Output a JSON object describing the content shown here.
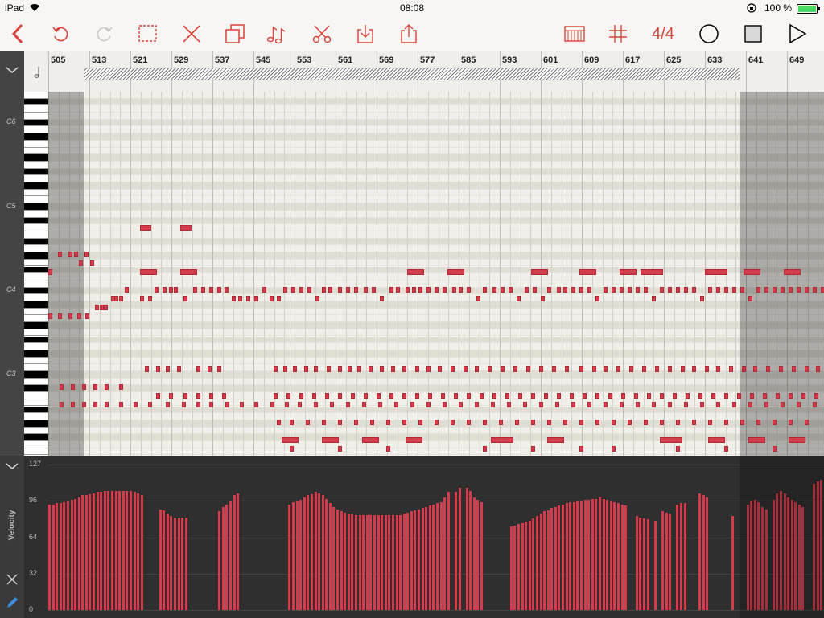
{
  "status": {
    "device": "iPad",
    "time": "08:08",
    "battery": "100 %"
  },
  "toolbar": {
    "back_icon": "chevron-left-icon",
    "time_signature": "4/4",
    "accent_color": "#d9443a"
  },
  "ruler": {
    "bars": [
      "505",
      "513",
      "521",
      "529",
      "537",
      "545",
      "553",
      "561",
      "569",
      "577",
      "585",
      "593",
      "601",
      "609",
      "617",
      "625",
      "633",
      "641",
      "649"
    ]
  },
  "keyboard": {
    "labels": [
      "C6",
      "C5",
      "C4",
      "C3"
    ]
  },
  "velocity": {
    "title": "Velocity",
    "levels": [
      "127",
      "96",
      "64",
      "32",
      "0"
    ]
  },
  "notes": [
    [
      0,
      7,
      1
    ],
    [
      12,
      5,
      1
    ],
    [
      25,
      5,
      1
    ],
    [
      32,
      5,
      1
    ],
    [
      38,
      6,
      1
    ],
    [
      45,
      5,
      1
    ],
    [
      52,
      6,
      1
    ],
    [
      0,
      12,
      1
    ],
    [
      12,
      12,
      1
    ],
    [
      25,
      12,
      1
    ],
    [
      36,
      12,
      1
    ],
    [
      46,
      12,
      1
    ],
    [
      58,
      11,
      1
    ],
    [
      64,
      11,
      1
    ],
    [
      69,
      11,
      1
    ],
    [
      78,
      10,
      1
    ],
    [
      82,
      10,
      1
    ],
    [
      88,
      10,
      1
    ],
    [
      95,
      9,
      1
    ],
    [
      114,
      10,
      1
    ],
    [
      124,
      10,
      1
    ],
    [
      132,
      9,
      1
    ],
    [
      142,
      9,
      1
    ],
    [
      150,
      9,
      1
    ],
    [
      156,
      9,
      1
    ],
    [
      168,
      10,
      1
    ],
    [
      180,
      9,
      1
    ],
    [
      190,
      9,
      1
    ],
    [
      200,
      9,
      1
    ],
    [
      210,
      9,
      1
    ],
    [
      219,
      9,
      1
    ],
    [
      228,
      10,
      1
    ],
    [
      236,
      10,
      1
    ],
    [
      246,
      10,
      1
    ],
    [
      256,
      10,
      1
    ],
    [
      266,
      9,
      1
    ],
    [
      275,
      10,
      1
    ],
    [
      284,
      10,
      1
    ],
    [
      292,
      9,
      1
    ],
    [
      302,
      9,
      1
    ],
    [
      312,
      9,
      1
    ],
    [
      322,
      9,
      1
    ],
    [
      332,
      10,
      1
    ],
    [
      340,
      9,
      1
    ],
    [
      348,
      9,
      1
    ],
    [
      360,
      9,
      1
    ],
    [
      370,
      9,
      1
    ],
    [
      380,
      9,
      1
    ],
    [
      392,
      9,
      1
    ],
    [
      402,
      9,
      1
    ],
    [
      412,
      10,
      1
    ],
    [
      424,
      9,
      1
    ],
    [
      432,
      9,
      1
    ],
    [
      444,
      9,
      1
    ],
    [
      452,
      9,
      1
    ],
    [
      460,
      9,
      1
    ],
    [
      470,
      9,
      1
    ],
    [
      480,
      9,
      1
    ],
    [
      490,
      9,
      1
    ],
    [
      502,
      9,
      1
    ],
    [
      510,
      9,
      1
    ],
    [
      520,
      9,
      1
    ],
    [
      532,
      10,
      1
    ],
    [
      540,
      9,
      1
    ],
    [
      552,
      9,
      1
    ],
    [
      562,
      9,
      1
    ],
    [
      572,
      9,
      1
    ],
    [
      582,
      10,
      1
    ],
    [
      592,
      9,
      1
    ],
    [
      602,
      9,
      1
    ],
    [
      612,
      10,
      1
    ],
    [
      620,
      9,
      1
    ],
    [
      632,
      9,
      1
    ],
    [
      640,
      9,
      1
    ],
    [
      650,
      9,
      1
    ],
    [
      660,
      9,
      1
    ],
    [
      670,
      9,
      1
    ],
    [
      680,
      10,
      1
    ],
    [
      690,
      9,
      1
    ],
    [
      700,
      9,
      1
    ],
    [
      710,
      9,
      1
    ],
    [
      720,
      9,
      1
    ],
    [
      730,
      9,
      1
    ],
    [
      740,
      9,
      1
    ],
    [
      750,
      10,
      1
    ],
    [
      760,
      9,
      1
    ],
    [
      770,
      9,
      1
    ],
    [
      780,
      9,
      1
    ],
    [
      790,
      9,
      1
    ],
    [
      800,
      9,
      1
    ],
    [
      810,
      10,
      1
    ],
    [
      820,
      9,
      1
    ],
    [
      830,
      9,
      1
    ],
    [
      840,
      9,
      1
    ],
    [
      850,
      9,
      1
    ],
    [
      860,
      9,
      1
    ],
    [
      870,
      10,
      1
    ],
    [
      880,
      9,
      1
    ],
    [
      890,
      9,
      1
    ],
    [
      900,
      9,
      1
    ],
    [
      910,
      9,
      1
    ],
    [
      920,
      9,
      1
    ],
    [
      930,
      9,
      1
    ],
    [
      940,
      9,
      1
    ],
    [
      950,
      9,
      1
    ],
    [
      960,
      9,
      1
    ],
    [
      114,
      7,
      3
    ],
    [
      164,
      7,
      3
    ],
    [
      114,
      2,
      2
    ],
    [
      164,
      2,
      2
    ],
    [
      446,
      7,
      3
    ],
    [
      496,
      7,
      3
    ],
    [
      600,
      7,
      3
    ],
    [
      660,
      7,
      3
    ],
    [
      710,
      7,
      3
    ],
    [
      736,
      7,
      4
    ],
    [
      816,
      7,
      4
    ],
    [
      864,
      7,
      3
    ],
    [
      914,
      7,
      3
    ],
    [
      120,
      18,
      1
    ],
    [
      134,
      18,
      1
    ],
    [
      146,
      18,
      1
    ],
    [
      160,
      18,
      1
    ],
    [
      184,
      18,
      1
    ],
    [
      198,
      18,
      1
    ],
    [
      210,
      18,
      1
    ],
    [
      280,
      18,
      1
    ],
    [
      292,
      18,
      1
    ],
    [
      304,
      18,
      1
    ],
    [
      318,
      18,
      1
    ],
    [
      330,
      18,
      1
    ],
    [
      346,
      18,
      1
    ],
    [
      360,
      18,
      1
    ],
    [
      372,
      18,
      1
    ],
    [
      384,
      18,
      1
    ],
    [
      398,
      18,
      1
    ],
    [
      412,
      18,
      1
    ],
    [
      426,
      18,
      1
    ],
    [
      440,
      18,
      1
    ],
    [
      456,
      18,
      1
    ],
    [
      470,
      18,
      1
    ],
    [
      484,
      18,
      1
    ],
    [
      500,
      18,
      1
    ],
    [
      516,
      18,
      1
    ],
    [
      530,
      18,
      1
    ],
    [
      546,
      18,
      1
    ],
    [
      562,
      18,
      1
    ],
    [
      578,
      18,
      1
    ],
    [
      594,
      18,
      1
    ],
    [
      610,
      18,
      1
    ],
    [
      626,
      18,
      1
    ],
    [
      642,
      18,
      1
    ],
    [
      660,
      18,
      1
    ],
    [
      676,
      18,
      1
    ],
    [
      690,
      18,
      1
    ],
    [
      706,
      18,
      1
    ],
    [
      722,
      18,
      1
    ],
    [
      738,
      18,
      1
    ],
    [
      754,
      18,
      1
    ],
    [
      770,
      18,
      1
    ],
    [
      786,
      18,
      1
    ],
    [
      800,
      18,
      1
    ],
    [
      816,
      18,
      1
    ],
    [
      830,
      18,
      1
    ],
    [
      846,
      18,
      1
    ],
    [
      862,
      18,
      1
    ],
    [
      876,
      18,
      1
    ],
    [
      892,
      18,
      1
    ],
    [
      908,
      18,
      1
    ],
    [
      924,
      18,
      1
    ],
    [
      940,
      18,
      1
    ],
    [
      954,
      18,
      1
    ],
    [
      134,
      21,
      1
    ],
    [
      150,
      21,
      1
    ],
    [
      168,
      21,
      1
    ],
    [
      184,
      21,
      1
    ],
    [
      200,
      21,
      1
    ],
    [
      216,
      21,
      1
    ],
    [
      280,
      21,
      1
    ],
    [
      296,
      21,
      1
    ],
    [
      312,
      21,
      1
    ],
    [
      328,
      21,
      1
    ],
    [
      344,
      21,
      1
    ],
    [
      360,
      21,
      1
    ],
    [
      376,
      21,
      1
    ],
    [
      392,
      21,
      1
    ],
    [
      408,
      21,
      1
    ],
    [
      424,
      21,
      1
    ],
    [
      440,
      21,
      1
    ],
    [
      456,
      21,
      1
    ],
    [
      472,
      21,
      1
    ],
    [
      488,
      21,
      1
    ],
    [
      504,
      21,
      1
    ],
    [
      520,
      21,
      1
    ],
    [
      536,
      21,
      1
    ],
    [
      552,
      21,
      1
    ],
    [
      568,
      21,
      1
    ],
    [
      584,
      21,
      1
    ],
    [
      600,
      21,
      1
    ],
    [
      616,
      21,
      1
    ],
    [
      632,
      21,
      1
    ],
    [
      648,
      21,
      1
    ],
    [
      664,
      21,
      1
    ],
    [
      680,
      21,
      1
    ],
    [
      696,
      21,
      1
    ],
    [
      712,
      21,
      1
    ],
    [
      728,
      21,
      1
    ],
    [
      744,
      21,
      1
    ],
    [
      760,
      21,
      1
    ],
    [
      776,
      21,
      1
    ],
    [
      792,
      21,
      1
    ],
    [
      808,
      21,
      1
    ],
    [
      824,
      21,
      1
    ],
    [
      840,
      21,
      1
    ],
    [
      856,
      21,
      1
    ],
    [
      872,
      21,
      1
    ],
    [
      888,
      21,
      1
    ],
    [
      904,
      21,
      1
    ],
    [
      920,
      21,
      1
    ],
    [
      936,
      21,
      1
    ],
    [
      952,
      21,
      1
    ],
    [
      284,
      24,
      1
    ],
    [
      300,
      24,
      1
    ],
    [
      320,
      24,
      1
    ],
    [
      340,
      24,
      1
    ],
    [
      360,
      24,
      1
    ],
    [
      380,
      24,
      1
    ],
    [
      400,
      24,
      1
    ],
    [
      420,
      24,
      1
    ],
    [
      440,
      24,
      1
    ],
    [
      460,
      24,
      1
    ],
    [
      480,
      24,
      1
    ],
    [
      500,
      24,
      1
    ],
    [
      520,
      24,
      1
    ],
    [
      540,
      24,
      1
    ],
    [
      560,
      24,
      1
    ],
    [
      580,
      24,
      1
    ],
    [
      600,
      24,
      1
    ],
    [
      620,
      24,
      1
    ],
    [
      640,
      24,
      1
    ],
    [
      660,
      24,
      1
    ],
    [
      680,
      24,
      1
    ],
    [
      700,
      24,
      1
    ],
    [
      720,
      24,
      1
    ],
    [
      740,
      24,
      1
    ],
    [
      760,
      24,
      1
    ],
    [
      780,
      24,
      1
    ],
    [
      800,
      24,
      1
    ],
    [
      820,
      24,
      1
    ],
    [
      840,
      24,
      1
    ],
    [
      860,
      24,
      1
    ],
    [
      880,
      24,
      1
    ],
    [
      900,
      24,
      1
    ],
    [
      920,
      24,
      1
    ],
    [
      940,
      24,
      1
    ],
    [
      290,
      26,
      3
    ],
    [
      340,
      26,
      3
    ],
    [
      390,
      26,
      3
    ],
    [
      444,
      26,
      3
    ],
    [
      550,
      26,
      4
    ],
    [
      620,
      26,
      3
    ],
    [
      760,
      26,
      4
    ],
    [
      820,
      26,
      3
    ],
    [
      870,
      26,
      3
    ],
    [
      920,
      26,
      3
    ],
    [
      300,
      27,
      1
    ],
    [
      360,
      27,
      1
    ],
    [
      420,
      27,
      1
    ],
    [
      540,
      27,
      1
    ],
    [
      600,
      27,
      1
    ],
    [
      660,
      27,
      1
    ],
    [
      700,
      27,
      1
    ],
    [
      780,
      27,
      1
    ],
    [
      840,
      27,
      1
    ],
    [
      900,
      27,
      1
    ],
    [
      14,
      22,
      1
    ],
    [
      28,
      22,
      1
    ],
    [
      42,
      22,
      1
    ],
    [
      56,
      22,
      1
    ],
    [
      70,
      22,
      1
    ],
    [
      14,
      20,
      1
    ],
    [
      28,
      20,
      1
    ],
    [
      42,
      20,
      1
    ],
    [
      56,
      20,
      1
    ],
    [
      70,
      20,
      1
    ],
    [
      88,
      20,
      1
    ],
    [
      88,
      22,
      1
    ],
    [
      106,
      22,
      1
    ],
    [
      124,
      22,
      1
    ],
    [
      146,
      22,
      1
    ],
    [
      166,
      22,
      1
    ],
    [
      184,
      22,
      1
    ],
    [
      200,
      22,
      1
    ],
    [
      220,
      22,
      1
    ],
    [
      238,
      22,
      1
    ],
    [
      256,
      22,
      1
    ],
    [
      276,
      22,
      1
    ],
    [
      294,
      22,
      1
    ],
    [
      310,
      22,
      1
    ],
    [
      330,
      22,
      1
    ],
    [
      350,
      22,
      1
    ],
    [
      370,
      22,
      1
    ],
    [
      390,
      22,
      1
    ],
    [
      410,
      22,
      1
    ],
    [
      430,
      22,
      1
    ],
    [
      450,
      22,
      1
    ],
    [
      470,
      22,
      1
    ],
    [
      490,
      22,
      1
    ],
    [
      510,
      22,
      1
    ],
    [
      530,
      22,
      1
    ],
    [
      550,
      22,
      1
    ],
    [
      570,
      22,
      1
    ],
    [
      590,
      22,
      1
    ],
    [
      610,
      22,
      1
    ],
    [
      630,
      22,
      1
    ],
    [
      650,
      22,
      1
    ],
    [
      670,
      22,
      1
    ],
    [
      690,
      22,
      1
    ],
    [
      710,
      22,
      1
    ],
    [
      730,
      22,
      1
    ],
    [
      750,
      22,
      1
    ],
    [
      770,
      22,
      1
    ],
    [
      790,
      22,
      1
    ],
    [
      810,
      22,
      1
    ],
    [
      830,
      22,
      1
    ],
    [
      850,
      22,
      1
    ],
    [
      870,
      22,
      1
    ],
    [
      890,
      22,
      1
    ],
    [
      910,
      22,
      1
    ],
    [
      930,
      22,
      1
    ],
    [
      950,
      22,
      1
    ],
    [
      300,
      29,
      1
    ],
    [
      322,
      29,
      1
    ],
    [
      346,
      29,
      1
    ],
    [
      370,
      29,
      1
    ],
    [
      566,
      29,
      1
    ],
    [
      586,
      29,
      1
    ],
    [
      590,
      29,
      1
    ]
  ],
  "velocities": [
    92,
    92,
    93,
    93,
    94,
    95,
    96,
    97,
    98,
    100,
    100,
    101,
    102,
    103,
    103,
    104,
    104,
    104,
    104,
    104,
    104,
    104,
    104,
    103,
    102,
    100,
    0,
    0,
    0,
    0,
    88,
    87,
    84,
    82,
    81,
    81,
    81,
    81,
    0,
    0,
    0,
    0,
    0,
    0,
    0,
    0,
    86,
    90,
    92,
    95,
    100,
    102,
    0,
    0,
    0,
    0,
    0,
    0,
    0,
    0,
    0,
    0,
    0,
    0,
    0,
    92,
    94,
    95,
    96,
    98,
    100,
    101,
    103,
    102,
    100,
    97,
    93,
    90,
    88,
    86,
    85,
    84,
    84,
    83,
    83,
    83,
    83,
    83,
    83,
    83,
    83,
    83,
    83,
    83,
    83,
    83,
    84,
    85,
    86,
    87,
    88,
    89,
    90,
    91,
    92,
    93,
    94,
    98,
    103,
    0,
    103,
    107,
    0,
    107,
    104,
    98,
    96,
    94,
    0,
    0,
    0,
    0,
    0,
    0,
    0,
    73,
    74,
    75,
    76,
    77,
    78,
    80,
    82,
    84,
    86,
    87,
    89,
    90,
    91,
    92,
    93,
    94,
    94,
    95,
    95,
    96,
    96,
    97,
    97,
    98,
    97,
    96,
    95,
    94,
    93,
    92,
    91,
    0,
    0,
    82,
    81,
    80,
    79,
    0,
    78,
    0,
    86,
    85,
    84,
    0,
    92,
    93,
    93,
    0,
    0,
    0,
    102,
    100,
    98,
    0,
    0,
    0,
    0,
    0,
    0,
    82,
    0,
    0,
    0,
    92,
    95,
    96,
    94,
    90,
    88,
    0,
    96,
    102,
    104,
    102,
    98,
    96,
    94,
    92,
    90,
    0,
    0,
    110,
    112,
    114
  ]
}
